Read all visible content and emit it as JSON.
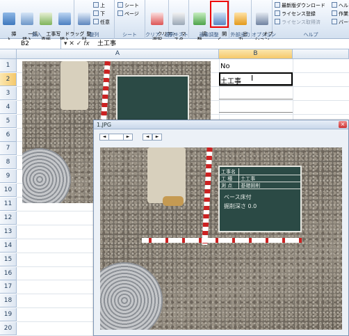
{
  "ribbon": {
    "groups": [
      {
        "label": "挿入",
        "buttons": [
          {
            "label": "挿\n入"
          },
          {
            "label": "一括\n挿入"
          },
          {
            "label": "工事写\n真帳"
          },
          {
            "label": "ドラッグ\n挿入"
          }
        ]
      },
      {
        "label": "整列",
        "buttons": [
          {
            "label": "整\n列"
          }
        ],
        "small": [
          "上",
          "下",
          "任意"
        ]
      },
      {
        "label": "シート",
        "small": [
          "シート",
          "ページ"
        ]
      },
      {
        "label": "クリア・選択",
        "buttons": [
          {
            "label": "クリア・\n選択"
          }
        ]
      },
      {
        "label": "テキスト",
        "buttons": [
          {
            "label": "マ\nスタ"
          }
        ]
      },
      {
        "label": "画像調整",
        "buttons": [
          {
            "label": "調\n整"
          },
          {
            "label": "開\nく"
          }
        ]
      },
      {
        "label": "外部出力",
        "buttons": [
          {
            "label": "出\n力"
          }
        ]
      },
      {
        "label": "オプション",
        "buttons": [
          {
            "label": "オプ\nション"
          }
        ]
      },
      {
        "label": "ヘルプ",
        "small": [
          "最新版ダウンロード",
          "ライセンス登録",
          "ライセンス取得済",
          "ヘルプ",
          "作業ガ",
          "バージョン"
        ]
      }
    ]
  },
  "formula_bar": {
    "name_box": "B2",
    "fx": "fx",
    "value": "土工事"
  },
  "columns": [
    {
      "label": "A"
    },
    {
      "label": "B"
    }
  ],
  "rows": [
    "1",
    "2",
    "3",
    "4",
    "5",
    "6",
    "7",
    "8",
    "9",
    "10",
    "11",
    "12",
    "13",
    "14",
    "15",
    "16",
    "17",
    "18",
    "19",
    "20"
  ],
  "cells": {
    "B1": "No",
    "B2": "土工事"
  },
  "board": {
    "rows": [
      {
        "k": "工事名",
        "v": ""
      },
      {
        "k": "工 種",
        "v": "土工事"
      },
      {
        "k": "測 点",
        "v": "基礎掘削"
      }
    ],
    "note1": "ベース床付",
    "note2": "掘削深さ 0.0"
  },
  "viewer": {
    "title": "1.JPG",
    "close_label": "×",
    "nav": [
      "◄",
      "►",
      "◄",
      "►"
    ]
  },
  "colors": {
    "accent": "#dfe9f5",
    "highlight": "#ff0000",
    "selected_header": "#f5c86a"
  }
}
